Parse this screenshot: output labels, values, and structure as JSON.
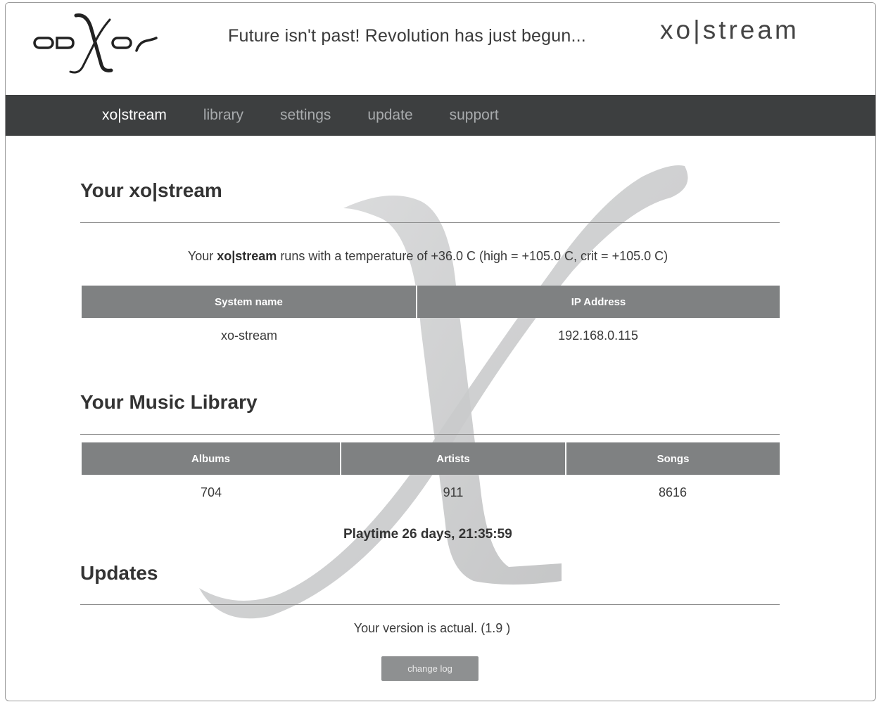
{
  "header": {
    "tagline": "Future isn't past! Revolution has just begun...",
    "brand": "xo|stream"
  },
  "nav": {
    "items": [
      {
        "label": "xo|stream",
        "active": true
      },
      {
        "label": "library",
        "active": false
      },
      {
        "label": "settings",
        "active": false
      },
      {
        "label": "update",
        "active": false
      },
      {
        "label": "support",
        "active": false
      }
    ]
  },
  "system": {
    "title": "Your xo|stream",
    "temp_prefix": "Your ",
    "temp_brand": "xo|stream",
    "temp_suffix": " runs with a temperature of +36.0 C (high = +105.0 C, crit = +105.0 C)",
    "col_system_name": "System name",
    "col_ip": "IP Address",
    "system_name": "xo-stream",
    "ip": "192.168.0.115"
  },
  "library": {
    "title": "Your Music Library",
    "col_albums": "Albums",
    "col_artists": "Artists",
    "col_songs": "Songs",
    "albums": "704",
    "artists": "911",
    "songs": "8616",
    "playtime": "Playtime 26 days, 21:35:59"
  },
  "updates": {
    "title": "Updates",
    "version_text": "Your version is actual. (1.9 )",
    "changelog_label": "change log"
  },
  "colors": {
    "nav_bg": "#3d3f40",
    "table_header": "#7f8182",
    "watermark": "#c9cacb"
  },
  "icons": {
    "logo": "odxos-logo",
    "watermark": "x-watermark"
  }
}
